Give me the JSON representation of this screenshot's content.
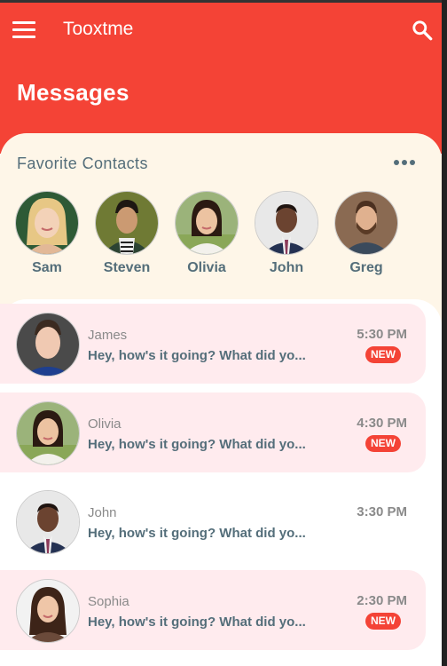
{
  "app": {
    "name": "Tooxtme",
    "accent": "#f44336"
  },
  "header": {
    "title": "Messages"
  },
  "favorites": {
    "title": "Favorite Contacts",
    "contacts": [
      {
        "name": "Sam"
      },
      {
        "name": "Steven"
      },
      {
        "name": "Olivia"
      },
      {
        "name": "John"
      },
      {
        "name": "Greg"
      }
    ]
  },
  "chats": [
    {
      "sender": "James",
      "preview": "Hey, how's it going? What did yo...",
      "time": "5:30 PM",
      "badge": "NEW",
      "unread": true
    },
    {
      "sender": "Olivia",
      "preview": "Hey, how's it going? What did yo...",
      "time": "4:30 PM",
      "badge": "NEW",
      "unread": true
    },
    {
      "sender": "John",
      "preview": "Hey, how's it going? What did yo...",
      "time": "3:30 PM",
      "badge": "",
      "unread": false
    },
    {
      "sender": "Sophia",
      "preview": "Hey, how's it going? What did yo...",
      "time": "2:30 PM",
      "badge": "NEW",
      "unread": true
    }
  ]
}
